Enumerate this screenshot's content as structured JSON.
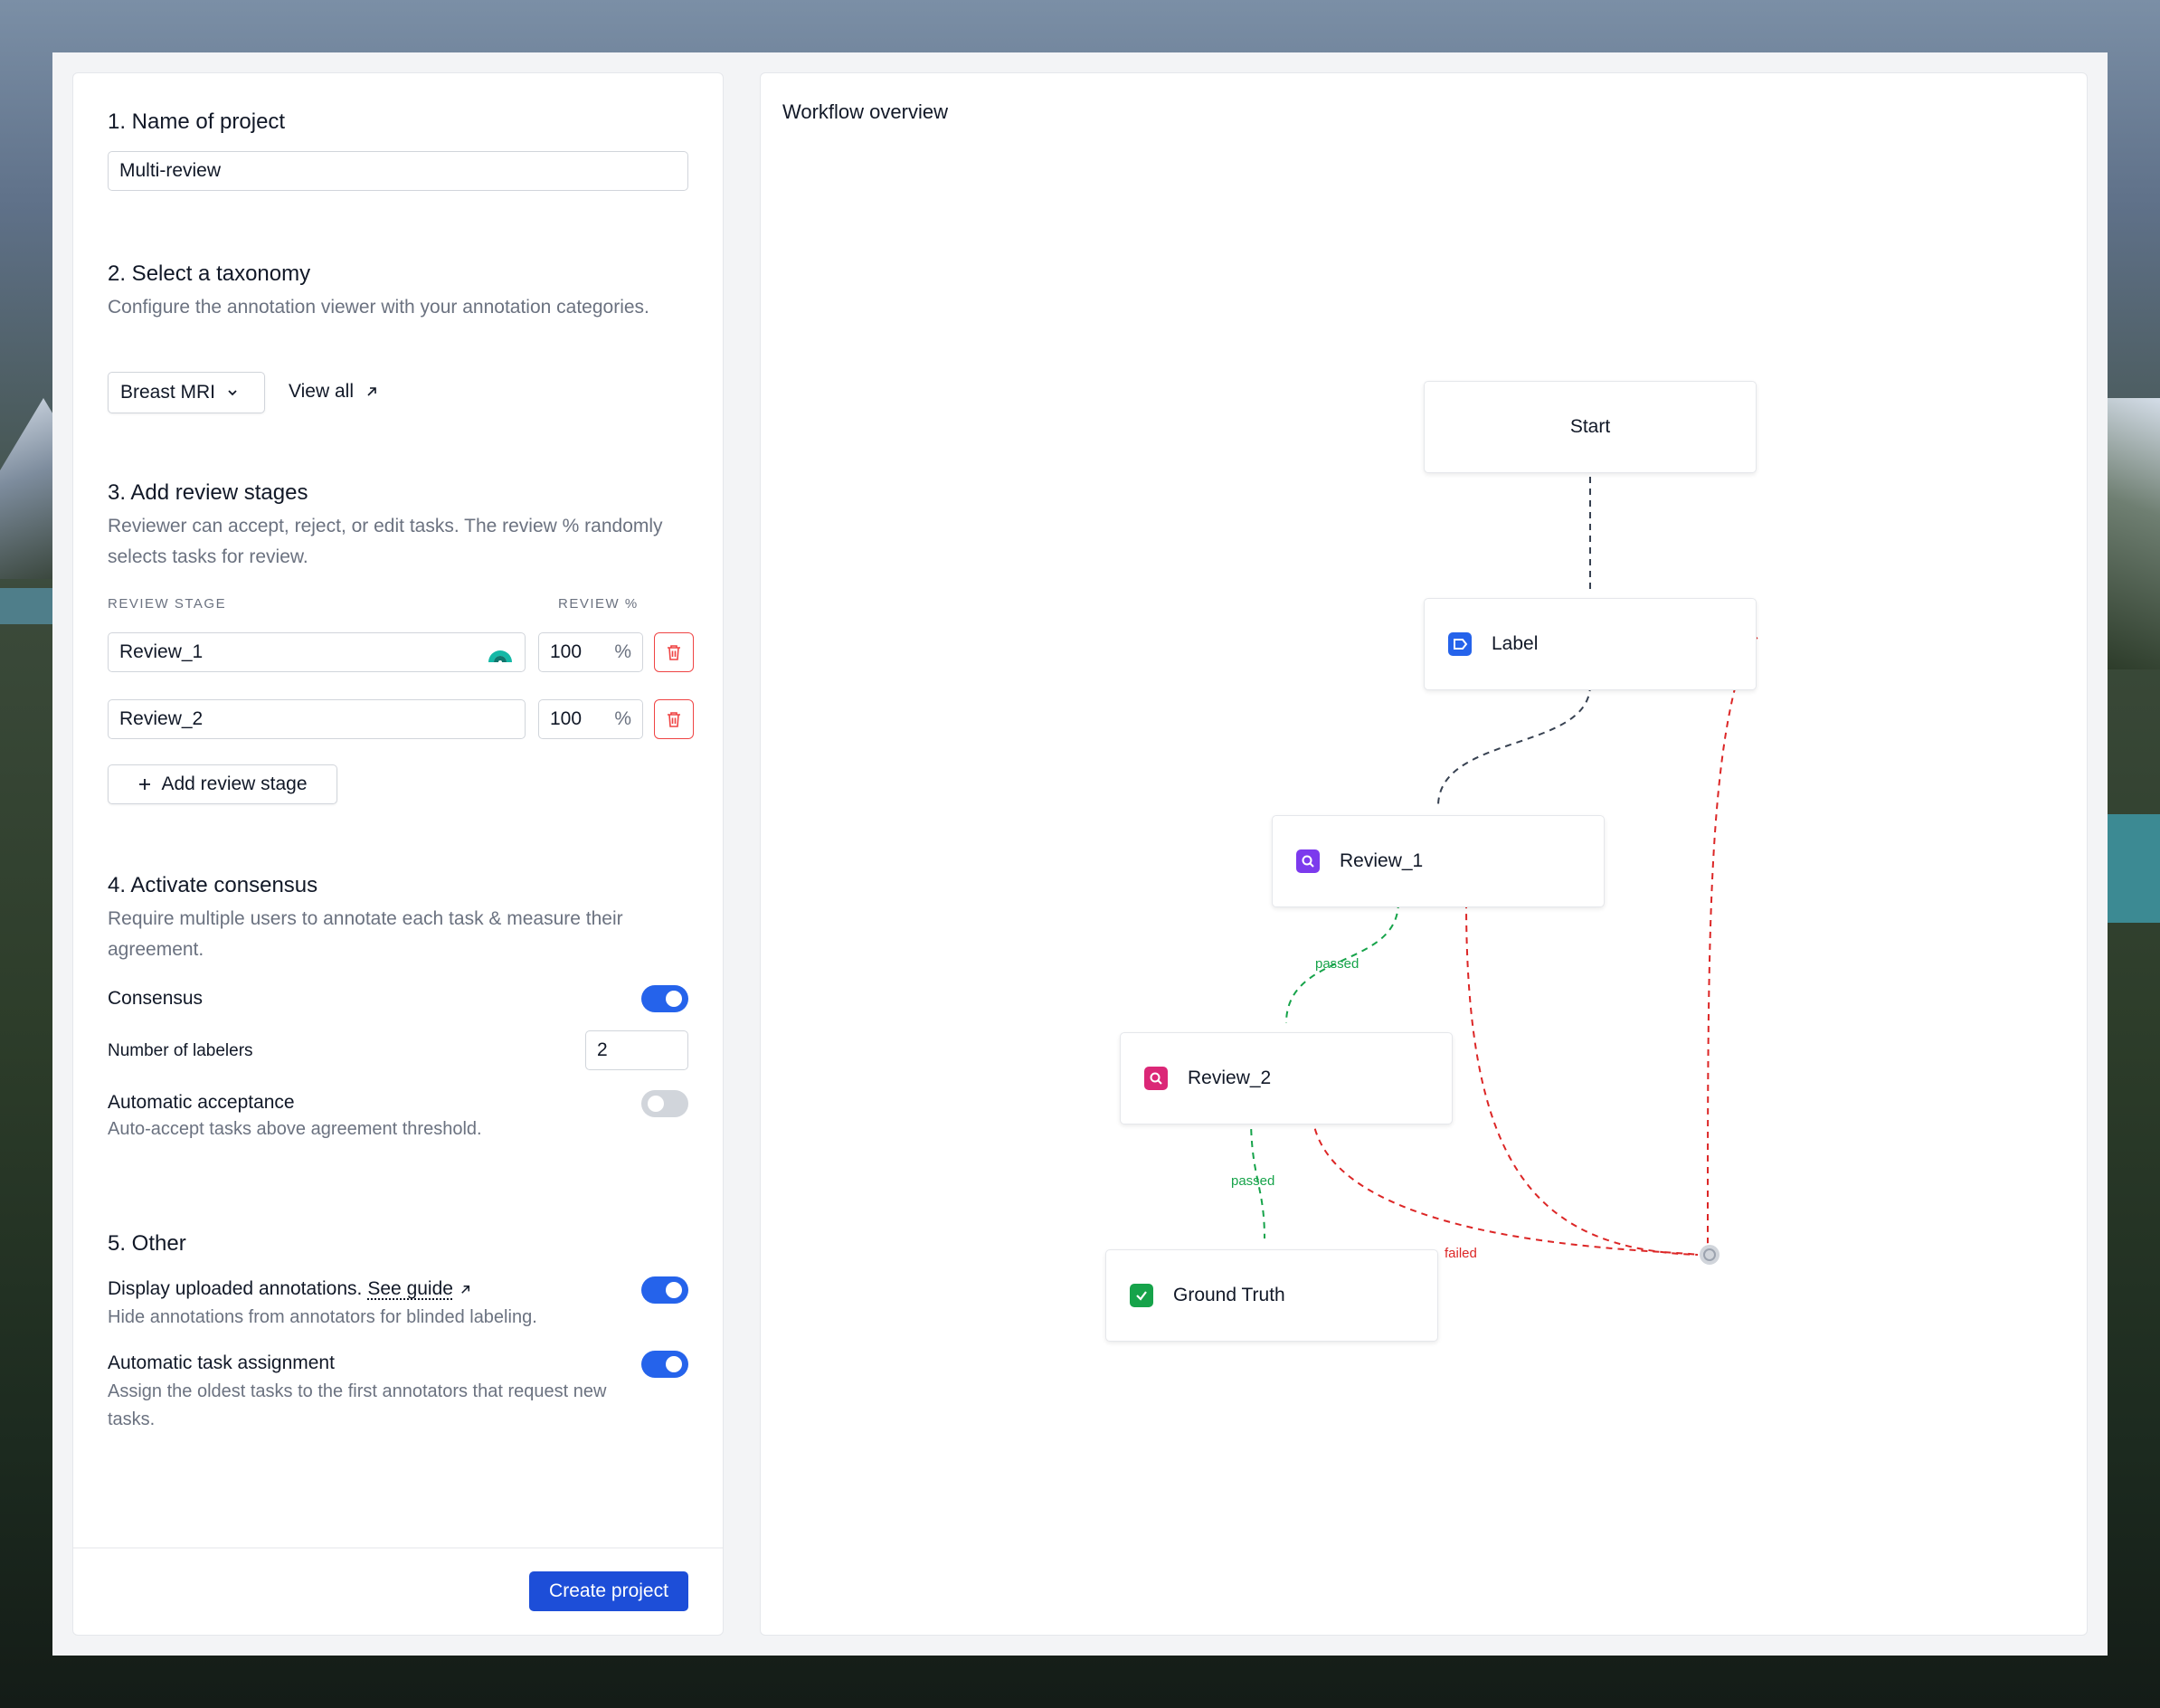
{
  "form": {
    "name_section": {
      "title": "1. Name of project",
      "value": "Multi-review"
    },
    "taxonomy_section": {
      "title": "2. Select a taxonomy",
      "description": "Configure the annotation viewer with your annotation categories.",
      "selected": "Breast MRI",
      "view_all_label": "View all"
    },
    "review_section": {
      "title": "3. Add review stages",
      "description": "Reviewer can accept, reject, or edit tasks. The review % randomly selects tasks for review.",
      "col_stage": "REVIEW STAGE",
      "col_percent": "REVIEW %",
      "stages": [
        {
          "name": "Review_1",
          "percent": "100"
        },
        {
          "name": "Review_2",
          "percent": "100"
        }
      ],
      "percent_symbol": "%",
      "add_label": "Add review stage"
    },
    "consensus_section": {
      "title": "4. Activate consensus",
      "description": "Require multiple users to annotate each task & measure their agreement.",
      "consensus_label": "Consensus",
      "labelers_label": "Number of labelers",
      "labelers_value": "2",
      "auto_accept_label": "Automatic acceptance",
      "auto_accept_desc": "Auto-accept tasks above agreement threshold."
    },
    "other_section": {
      "title": "5. Other",
      "display_label": "Display uploaded annotations.",
      "guide_link": "See guide",
      "display_desc": "Hide annotations from annotators for blinded labeling.",
      "assign_label": "Automatic task assignment",
      "assign_desc": "Assign the oldest tasks to the first annotators that request new tasks."
    },
    "create_label": "Create project"
  },
  "workflow": {
    "title": "Workflow overview",
    "nodes": {
      "start": "Start",
      "label": "Label",
      "review1": "Review_1",
      "review2": "Review_2",
      "ground_truth": "Ground Truth"
    },
    "edge_passed": "passed",
    "edge_failed": "failed"
  },
  "colors": {
    "accent": "#2563eb",
    "danger": "#ef4444",
    "passed": "#16a34a",
    "failed": "#dc2626"
  }
}
